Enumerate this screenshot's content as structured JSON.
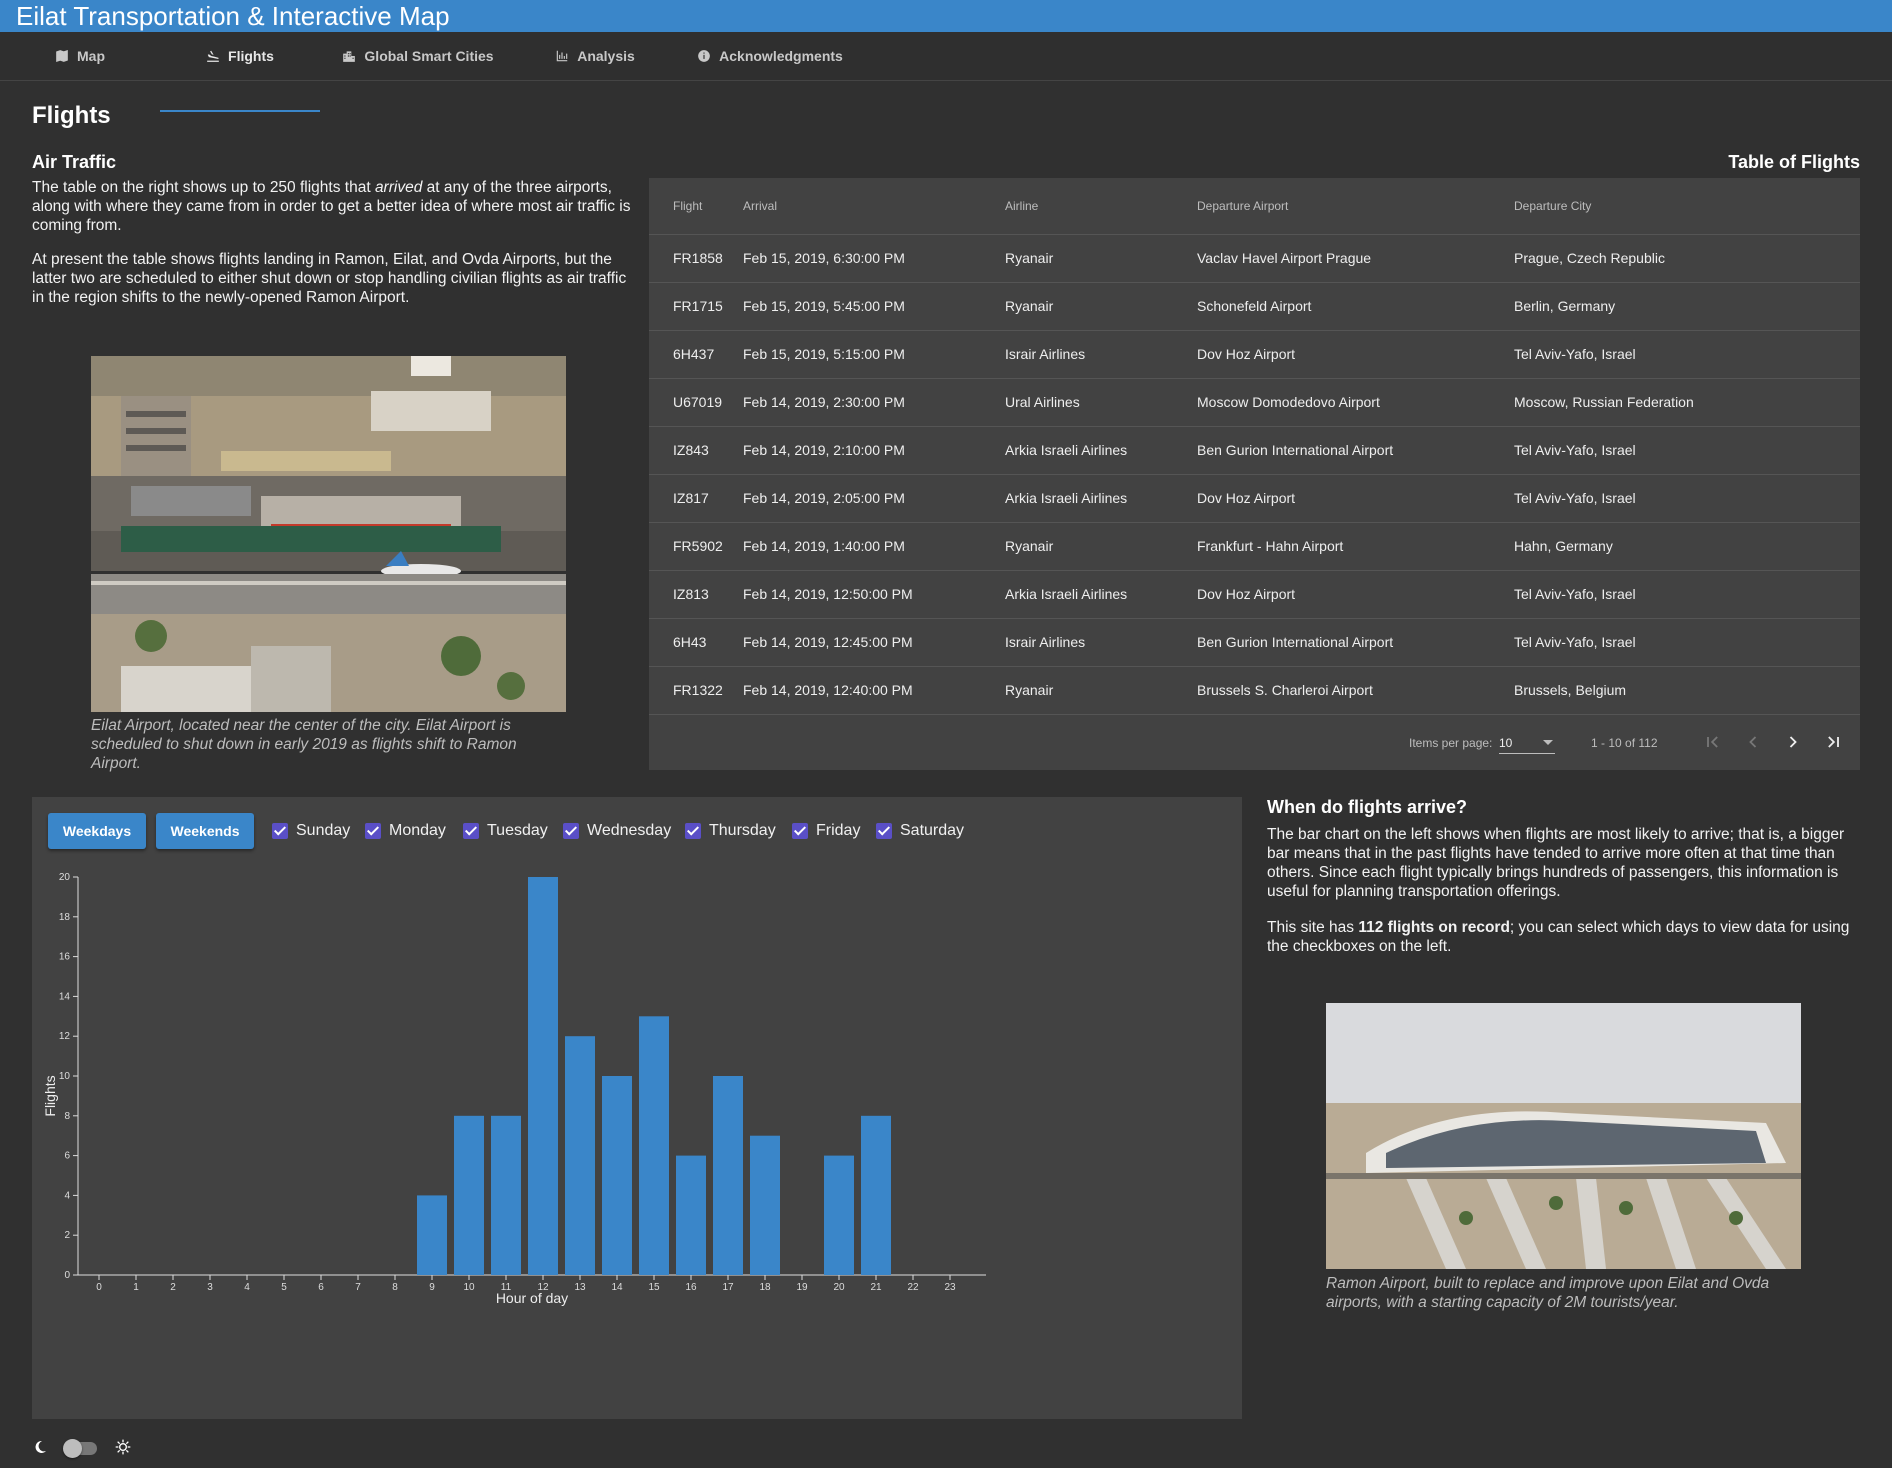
{
  "app": {
    "title": "Eilat Transportation & Interactive Map"
  },
  "tabs": [
    {
      "label": "Map",
      "icon": "map-icon"
    },
    {
      "label": "Flights",
      "icon": "flight-landing-icon",
      "active": true
    },
    {
      "label": "Global Smart Cities",
      "icon": "city-icon"
    },
    {
      "label": "Analysis",
      "icon": "bar-chart-icon"
    },
    {
      "label": "Acknowledgments",
      "icon": "info-icon"
    }
  ],
  "page": {
    "heading": "Flights"
  },
  "air_traffic": {
    "heading": "Air Traffic",
    "p1_before": "The table on the right shows up to 250 flights that ",
    "p1_em": "arrived",
    "p1_after": " at any of the three airports, along with where they came from in order to get a better idea of where most air traffic is coming from.",
    "p2": "At present the table shows flights landing in Ramon, Eilat, and Ovda Airports, but the latter two are scheduled to either shut down or stop handling civilian flights as air traffic in the region shifts to the newly-opened Ramon Airport.",
    "photo_caption": "Eilat Airport, located near the center of the city. Eilat Airport is scheduled to shut down in early 2019 as flights shift to Ramon Airport."
  },
  "table": {
    "heading": "Table of Flights",
    "columns": [
      "Flight",
      "Arrival",
      "Airline",
      "Departure Airport",
      "Departure City"
    ],
    "rows": [
      [
        "FR1858",
        "Feb 15, 2019, 6:30:00 PM",
        "Ryanair",
        "Vaclav Havel Airport Prague",
        "Prague, Czech Republic"
      ],
      [
        "FR1715",
        "Feb 15, 2019, 5:45:00 PM",
        "Ryanair",
        "Schonefeld Airport",
        "Berlin, Germany"
      ],
      [
        "6H437",
        "Feb 15, 2019, 5:15:00 PM",
        "Israir Airlines",
        "Dov Hoz Airport",
        "Tel Aviv-Yafo, Israel"
      ],
      [
        "U67019",
        "Feb 14, 2019, 2:30:00 PM",
        "Ural Airlines",
        "Moscow Domodedovo Airport",
        "Moscow, Russian Federation"
      ],
      [
        "IZ843",
        "Feb 14, 2019, 2:10:00 PM",
        "Arkia Israeli Airlines",
        "Ben Gurion International Airport",
        "Tel Aviv-Yafo, Israel"
      ],
      [
        "IZ817",
        "Feb 14, 2019, 2:05:00 PM",
        "Arkia Israeli Airlines",
        "Dov Hoz Airport",
        "Tel Aviv-Yafo, Israel"
      ],
      [
        "FR5902",
        "Feb 14, 2019, 1:40:00 PM",
        "Ryanair",
        "Frankfurt - Hahn Airport",
        "Hahn, Germany"
      ],
      [
        "IZ813",
        "Feb 14, 2019, 12:50:00 PM",
        "Arkia Israeli Airlines",
        "Dov Hoz Airport",
        "Tel Aviv-Yafo, Israel"
      ],
      [
        "6H43",
        "Feb 14, 2019, 12:45:00 PM",
        "Israir Airlines",
        "Ben Gurion International Airport",
        "Tel Aviv-Yafo, Israel"
      ],
      [
        "FR1322",
        "Feb 14, 2019, 12:40:00 PM",
        "Ryanair",
        "Brussels S. Charleroi Airport",
        "Brussels, Belgium"
      ]
    ],
    "paginator": {
      "items_per_page_label": "Items per page:",
      "items_per_page": "10",
      "range": "1 - 10 of 112"
    }
  },
  "filters": {
    "weekdays_button": "Weekdays",
    "weekends_button": "Weekends",
    "days": [
      {
        "label": "Sunday",
        "checked": true
      },
      {
        "label": "Monday",
        "checked": true
      },
      {
        "label": "Tuesday",
        "checked": true
      },
      {
        "label": "Wednesday",
        "checked": true
      },
      {
        "label": "Thursday",
        "checked": true
      },
      {
        "label": "Friday",
        "checked": true
      },
      {
        "label": "Saturday",
        "checked": true
      }
    ]
  },
  "chart_data": {
    "type": "bar",
    "xlabel": "Hour of day",
    "ylabel": "Flights",
    "categories": [
      "0",
      "1",
      "2",
      "3",
      "4",
      "5",
      "6",
      "7",
      "8",
      "9",
      "10",
      "11",
      "12",
      "13",
      "14",
      "15",
      "16",
      "17",
      "18",
      "19",
      "20",
      "21",
      "22",
      "23"
    ],
    "values": [
      0,
      0,
      0,
      0,
      0,
      0,
      0,
      0,
      0,
      4,
      8,
      8,
      20,
      12,
      10,
      13,
      6,
      10,
      7,
      0,
      6,
      8,
      0,
      0
    ],
    "ylim": [
      0,
      20
    ],
    "yticks": [
      0,
      2,
      4,
      6,
      8,
      10,
      12,
      14,
      16,
      18,
      20
    ],
    "bar_color": "#3a86c9",
    "grid": false,
    "legend": "none"
  },
  "when": {
    "heading": "When do flights arrive?",
    "p3": "The bar chart on the left shows when flights are most likely to arrive; that is, a bigger bar means that in the past flights have tended to arrive more often at that time than others. Since each flight typically brings hundreds of passengers, this information is useful for planning transportation offerings.",
    "p4_before": "This site has ",
    "p4_bold": "112 flights on record",
    "p4_after": "; you can select which days to view data for using the checkboxes on the left.",
    "photo_caption": "Ramon Airport, built to replace and improve upon Eilat and Ovda airports, with a starting capacity of 2M tourists/year."
  },
  "theme_toggle": {
    "dark_icon": "moon-icon",
    "light_icon": "sun-icon",
    "state": "dark"
  },
  "colors": {
    "accent": "#3a86c9",
    "background": "#303030",
    "card": "#424242",
    "checkbox": "#5a4fc7"
  }
}
